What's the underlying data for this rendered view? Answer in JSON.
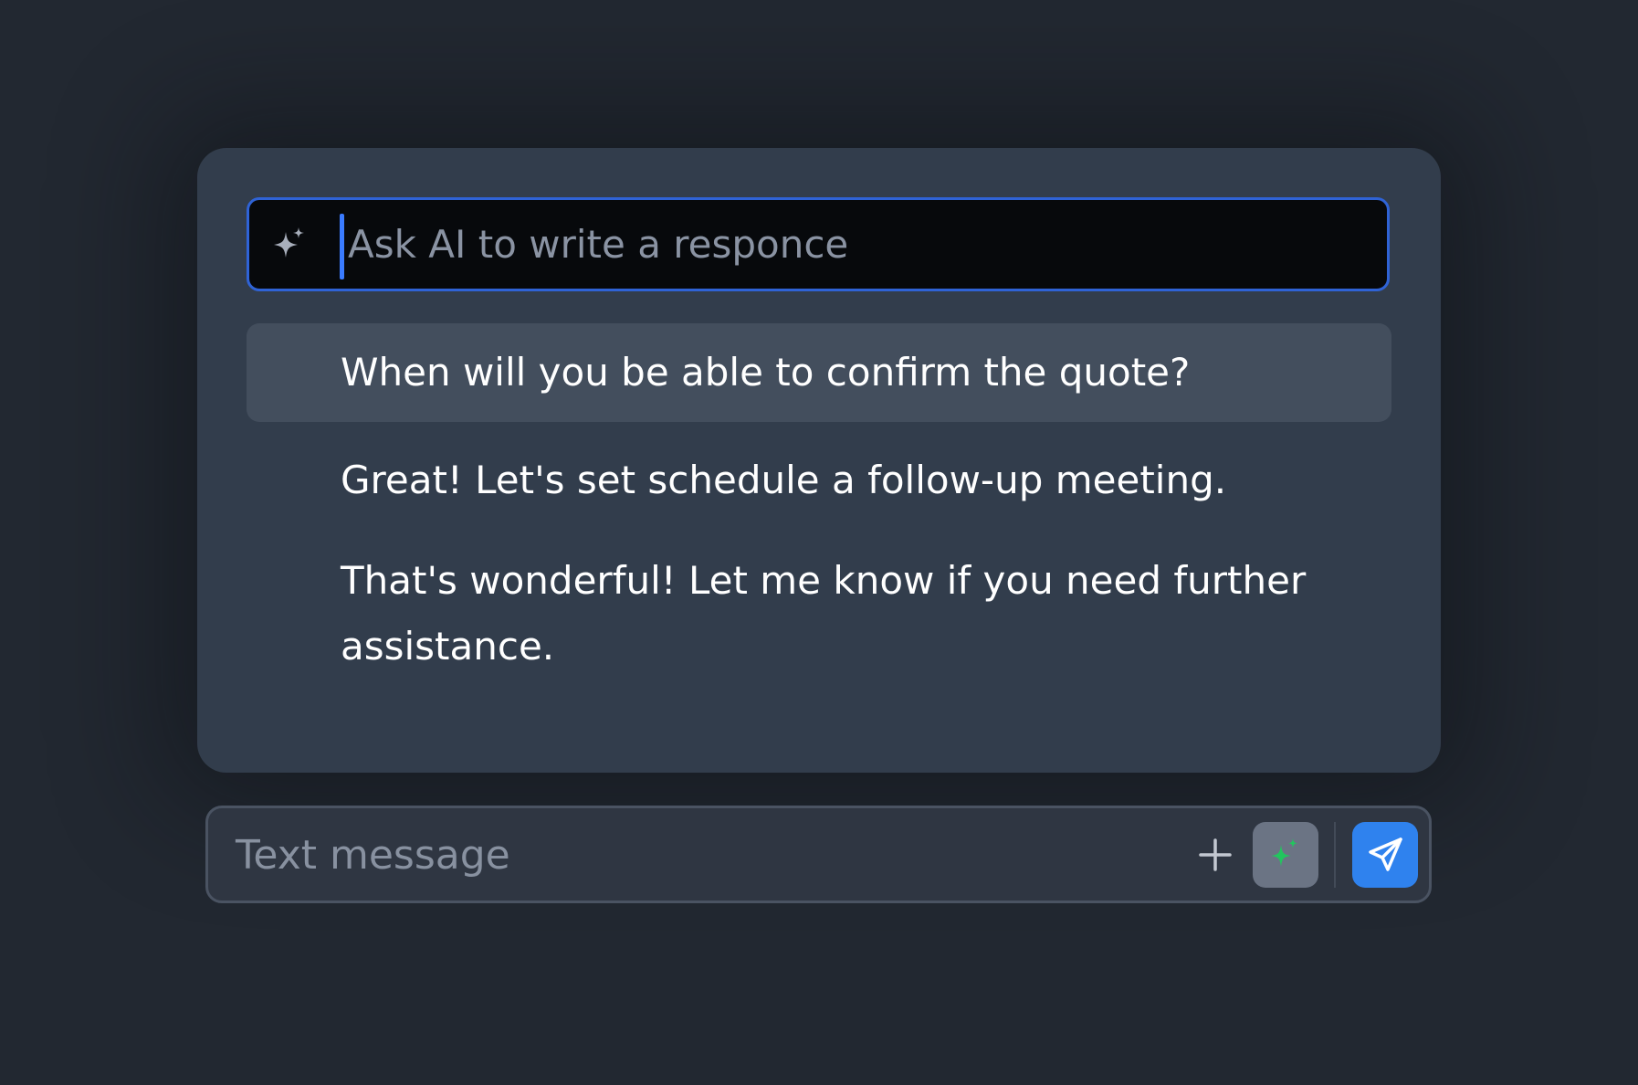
{
  "ai_panel": {
    "prompt_placeholder": "Ask AI to write a responce",
    "suggestions": [
      {
        "text": "When will you be able to confirm the quote?",
        "highlighted": true
      },
      {
        "text": "Great! Let's set schedule a  follow-up meeting.",
        "highlighted": false
      },
      {
        "text": "That's wonderful! Let me know if you need further assistance.",
        "highlighted": false
      }
    ]
  },
  "composer": {
    "placeholder": "Text message",
    "icons": {
      "add": "plus-icon",
      "ai": "sparkle-icon",
      "send": "paper-plane-icon"
    }
  },
  "colors": {
    "background": "#222831",
    "panel": "#323d4c",
    "highlight": "#434e5d",
    "accent_blue": "#2f82ee",
    "sparkle_green": "#22c55e"
  }
}
